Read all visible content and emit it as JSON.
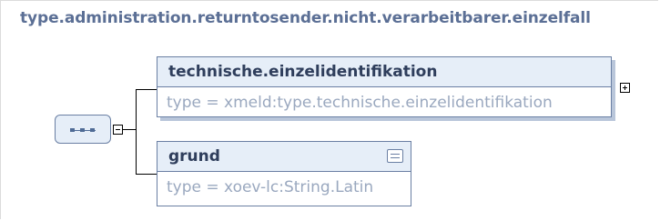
{
  "diagram": {
    "title": "type.administration.returntosender.nicht.verarbeitbarer.einzelfall",
    "elements": [
      {
        "name": "technische.einzelidentifikation",
        "type": "type = xmeld:type.technische.einzelidentifikation",
        "expandable": true,
        "has_documentation": false
      },
      {
        "name": "grund",
        "type": "type = xoev-lc:String.Latin",
        "expandable": false,
        "has_documentation": true
      }
    ],
    "compositor": "sequence",
    "icons": {
      "compositor": "sequence-icon",
      "collapse": "minus-toggle-icon",
      "expand": "plus-toggle-icon",
      "doc": "documentation-icon"
    },
    "colors": {
      "title": "#5b6f95",
      "box_border": "#6a7fa3",
      "box_header": "#e6eef8",
      "type_text": "#9aa8bf"
    }
  }
}
